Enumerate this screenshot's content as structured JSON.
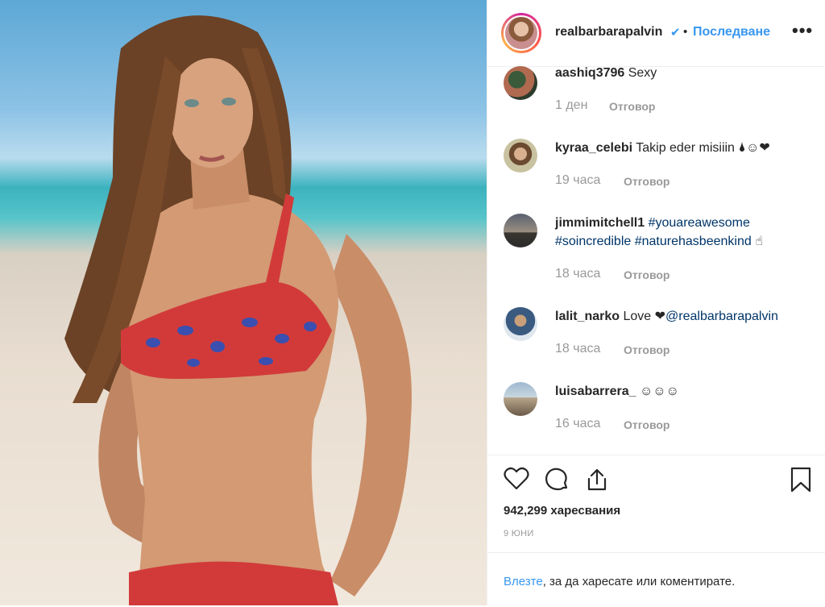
{
  "post": {
    "username": "realbarbarapalvin",
    "verified_glyph": "✔",
    "separator": "•",
    "follow_label": "Последване",
    "more_label": "•••",
    "likes": "942,299 харесвания",
    "date": "9 ЮНИ"
  },
  "comments": [
    {
      "user": "aashiq3796",
      "text": "Sexy",
      "time": "1 ден",
      "reply": "Отговор"
    },
    {
      "user": "kyraa_celebi",
      "text": "Takip eder misiiin 🌢☺❤",
      "time": "19 часа",
      "reply": "Отговор"
    },
    {
      "user": "jimmimitchell1",
      "tag1": "#youareawesome",
      "tag2": "#soincredible",
      "tag3": "#naturehasbeenkind",
      "tail": "☝",
      "time": "18 часа",
      "reply": "Отговор"
    },
    {
      "user": "lalit_narko",
      "text": "Love ❤",
      "mention": "@realbarbarapalvin",
      "time": "18 часа",
      "reply": "Отговор"
    },
    {
      "user": "luisabarrera_",
      "text": "☺☺☺",
      "time": "16 часа",
      "reply": "Отговор"
    }
  ],
  "actions": {
    "like_icon": "heart-icon",
    "comment_icon": "speech-bubble-icon",
    "share_icon": "share-icon",
    "save_icon": "bookmark-icon"
  },
  "login": {
    "link": "Влезте",
    "rest": ", за да харесате или коментирате."
  },
  "colors": {
    "accent": "#3897f0",
    "text": "#262626",
    "muted": "#999999",
    "border": "#efefef"
  }
}
